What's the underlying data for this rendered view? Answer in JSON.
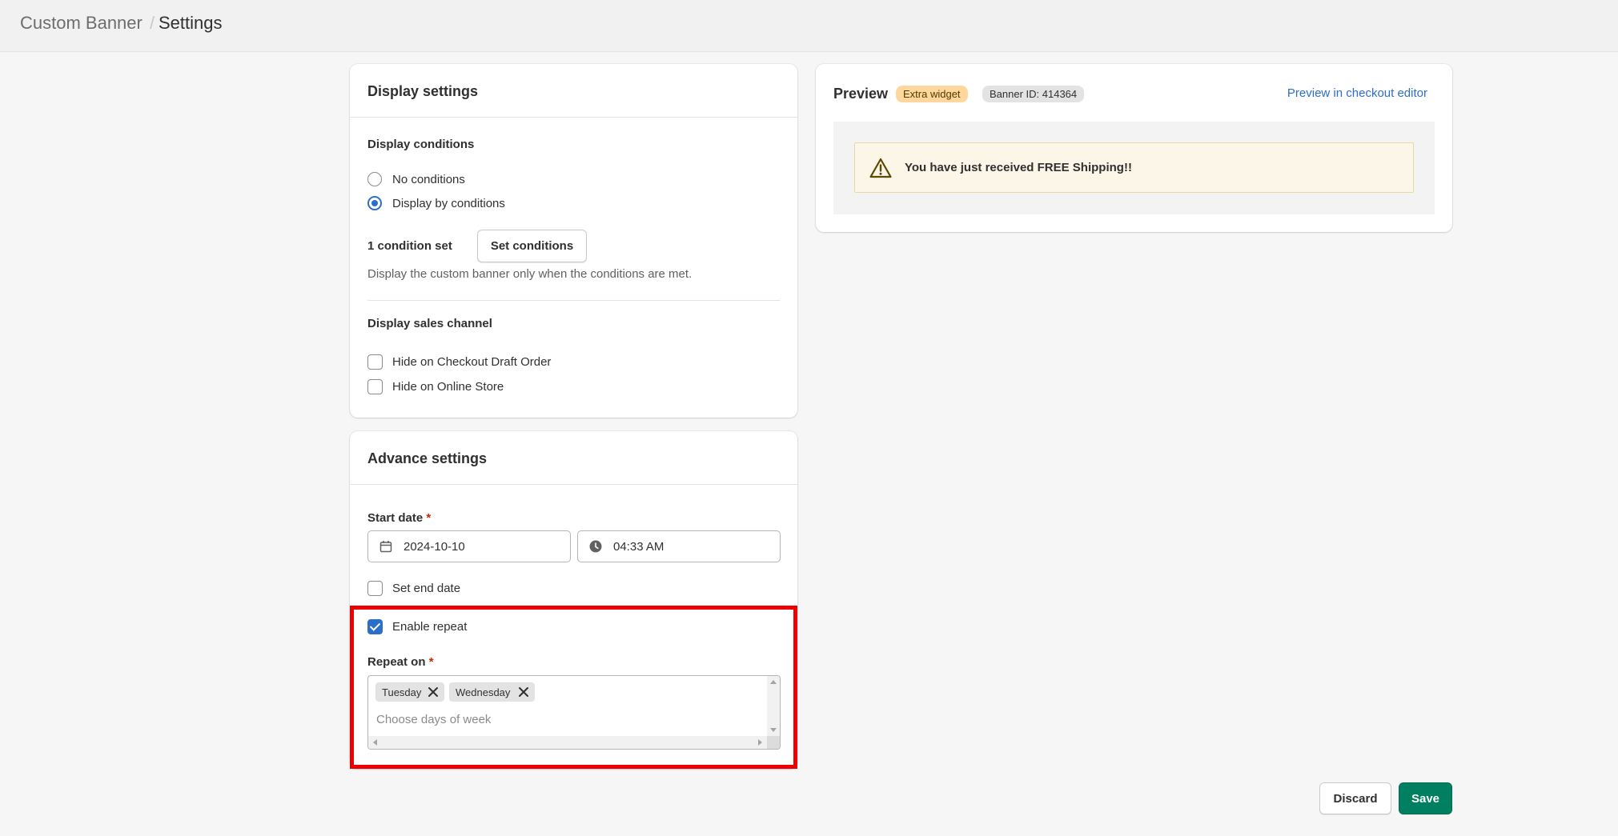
{
  "breadcrumb": {
    "parent": "Custom Banner",
    "separator": "/",
    "current": "Settings"
  },
  "display_settings": {
    "title": "Display settings",
    "conditions_label": "Display conditions",
    "options": [
      "No conditions",
      "Display by conditions"
    ],
    "selected_option": "Display by conditions",
    "condition_count": "1 condition set",
    "set_conditions_button": "Set conditions",
    "help_text": "Display the custom banner only when the conditions are met.",
    "sales_channel_label": "Display sales channel",
    "channels": [
      {
        "label": "Hide on Checkout Draft Order",
        "checked": false
      },
      {
        "label": "Hide on Online Store",
        "checked": false
      }
    ]
  },
  "advance_settings": {
    "title": "Advance settings",
    "start_date_label": "Start date",
    "required_mark": "*",
    "start_date": "2024-10-10",
    "start_time": "04:33 AM",
    "set_end_date_label": "Set end date",
    "set_end_date_checked": false,
    "enable_repeat_label": "Enable repeat",
    "enable_repeat_checked": true,
    "repeat_on_label": "Repeat on",
    "repeat_days": [
      "Tuesday",
      "Wednesday"
    ],
    "repeat_placeholder": "Choose days of week"
  },
  "preview": {
    "title": "Preview",
    "badge_widget": "Extra widget",
    "badge_id": "Banner ID: 414364",
    "link": "Preview in checkout editor",
    "banner_message": "You have just received FREE Shipping!!"
  },
  "footer": {
    "discard_label": "Discard",
    "save_label": "Save"
  },
  "icons": {
    "calendar": "calendar-icon",
    "clock": "clock-icon",
    "warning": "warning-icon",
    "remove": "x-icon"
  },
  "colors": {
    "accent": "#2c6ecb",
    "save_button": "#008060",
    "highlight": "#ee0000",
    "badge_widget_bg": "#ffd79d",
    "banner_bg": "#fcf6e9",
    "banner_border": "#e8d8a8"
  }
}
